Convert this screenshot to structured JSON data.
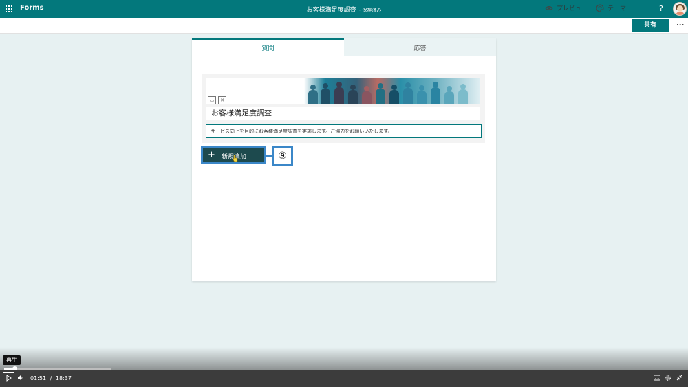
{
  "app_bar": {
    "app_name": "Forms",
    "doc_title": "お客様満足度調査",
    "save_status": "- 保存済み",
    "help_label": "?"
  },
  "command_bar": {
    "preview_label": "プレビュー",
    "theme_label": "テーマ",
    "share_label": "共有",
    "more_label": "..."
  },
  "tabs": [
    {
      "label": "質問",
      "active": true
    },
    {
      "label": "応答",
      "active": false
    }
  ],
  "form": {
    "title": "お客様満足度調査",
    "description": "サービス向上を目的にお客様満足度調査を実施します。ご協力をお願いいたします。"
  },
  "add_button": {
    "label": "新規追加",
    "icon": "plus-icon"
  },
  "annotation": {
    "marker": "⑨"
  },
  "player": {
    "tooltip": "再生",
    "current_time": "01:51",
    "separator": "/",
    "duration": "18:37",
    "progress_fraction": 0.099
  },
  "colors": {
    "brand": "#03787c",
    "background": "#e7f1f2",
    "highlight": "#3b87c8",
    "add_button_bg": "#1d4a4e"
  }
}
